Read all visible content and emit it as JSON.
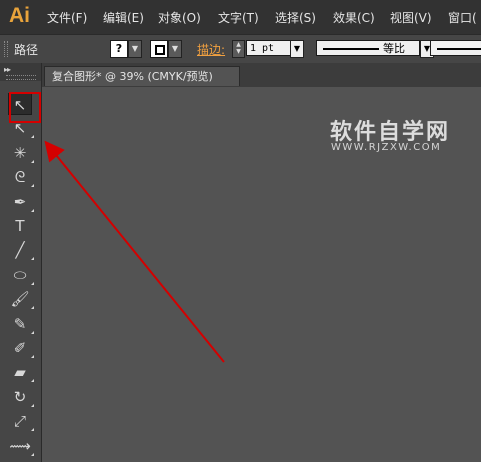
{
  "app": {
    "logo": "Ai"
  },
  "menu": [
    {
      "label": "文件(F)"
    },
    {
      "label": "编辑(E)"
    },
    {
      "label": "对象(O)"
    },
    {
      "label": "文字(T)"
    },
    {
      "label": "选择(S)"
    },
    {
      "label": "效果(C)"
    },
    {
      "label": "视图(V)"
    },
    {
      "label": "窗口("
    }
  ],
  "control_bar": {
    "selection_label": "路径",
    "fill_swatch": "?",
    "stroke_label": "描边:",
    "stroke_weight": "1 pt",
    "profile_label": "等比"
  },
  "document": {
    "tab_title": "复合图形* @ 39% (CMYK/预览)",
    "zoom_percent": 39,
    "color_mode": "CMYK"
  },
  "watermark": {
    "title": "软件自学网",
    "url": "WWW.RJZXW.COM"
  },
  "tools": [
    {
      "name": "selection-tool-icon",
      "glyph": "↖"
    },
    {
      "name": "direct-selection-tool-icon",
      "glyph": "↖"
    },
    {
      "name": "magic-wand-tool-icon",
      "glyph": "✳"
    },
    {
      "name": "lasso-tool-icon",
      "glyph": "ᘓ"
    },
    {
      "name": "pen-tool-icon",
      "glyph": "✒"
    },
    {
      "name": "type-tool-icon",
      "glyph": "T"
    },
    {
      "name": "line-segment-tool-icon",
      "glyph": "╱"
    },
    {
      "name": "ellipse-tool-icon",
      "glyph": "⬭"
    },
    {
      "name": "paintbrush-tool-icon",
      "glyph": "🖌"
    },
    {
      "name": "pencil-tool-icon",
      "glyph": "✎"
    },
    {
      "name": "blob-brush-tool-icon",
      "glyph": "✐"
    },
    {
      "name": "eraser-tool-icon",
      "glyph": "▰"
    },
    {
      "name": "rotate-tool-icon",
      "glyph": "↻"
    },
    {
      "name": "scale-tool-icon",
      "glyph": "⤢"
    },
    {
      "name": "width-tool-icon",
      "glyph": "⟿"
    }
  ],
  "annotation": {
    "color": "#d40000"
  }
}
